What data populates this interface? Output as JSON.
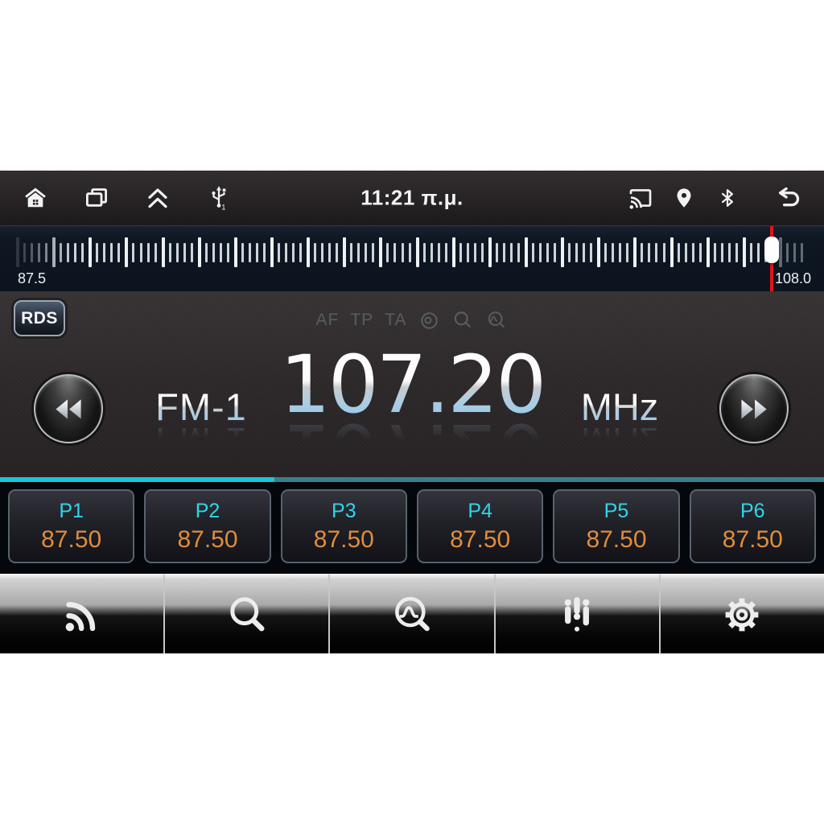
{
  "status_bar": {
    "time": "11:21 π.μ.",
    "icons_left": [
      "home",
      "recents",
      "collapse-up",
      "usb"
    ],
    "icons_right": [
      "cast",
      "location",
      "bluetooth",
      "back"
    ]
  },
  "tuner": {
    "rds_label": "RDS",
    "flags": [
      "AF",
      "TP",
      "TA"
    ],
    "flag_icons": [
      "loop",
      "search",
      "scan"
    ],
    "band": "FM-1",
    "frequency": "107.20",
    "unit": "MHz"
  },
  "ruler": {
    "min_label": "87.5",
    "max_label": "108.0",
    "tick_count": 109,
    "major_every": 5,
    "indicator_pct": 96.1,
    "fade_in_ticks": 8
  },
  "tuner_line": {
    "bright_pct": 33.3
  },
  "presets": [
    {
      "name": "P1",
      "freq": "87.50"
    },
    {
      "name": "P2",
      "freq": "87.50"
    },
    {
      "name": "P3",
      "freq": "87.50"
    },
    {
      "name": "P4",
      "freq": "87.50"
    },
    {
      "name": "P5",
      "freq": "87.50"
    },
    {
      "name": "P6",
      "freq": "87.50"
    }
  ],
  "toolbar": {
    "buttons": [
      "broadcast",
      "search",
      "scan",
      "equalizer",
      "settings"
    ]
  },
  "colors": {
    "accent_cyan": "#17c5da",
    "accent_cyan_dim": "#3b7e8b",
    "preset_label": "#2ed7e8",
    "preset_value": "#df8d3c",
    "indicator_red": "#e0151b",
    "freq_text_blue": "#89c3ee"
  }
}
